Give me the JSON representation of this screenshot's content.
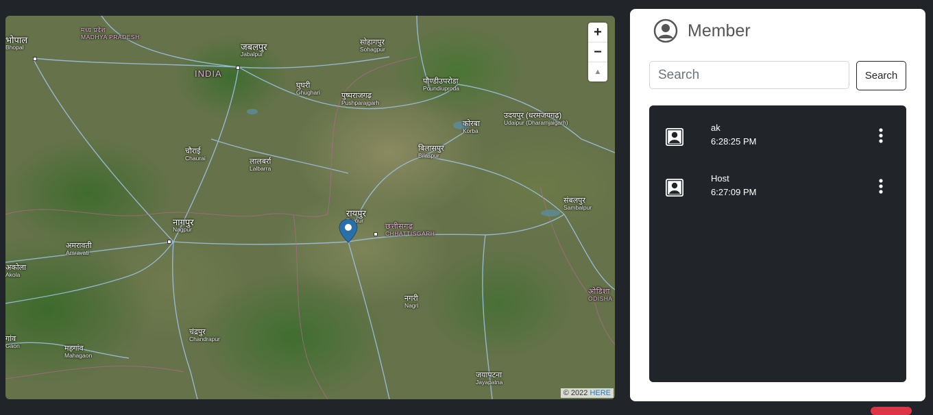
{
  "map": {
    "labels": {
      "bhopal_hi": "भोपाल",
      "bhopal": "Bhopal",
      "mp_hi": "मध्य प्रदेश",
      "mp": "MADHYA PRADESH",
      "jabalpur_hi": "जबलपुर",
      "jabalpur": "Jabalpur",
      "india": "INDIA",
      "sohagpur_hi": "सोहागपुर",
      "sohagpur": "Sohagpur",
      "ghughri_hi": "घुघरी",
      "ghughri": "Ghughari",
      "pushparajgarh_hi": "पुष्पराजगढ़",
      "pushparajgarh": "Pushparajgarh",
      "pondi_hi": "पौण्डीउपरोडा",
      "pondi": "Poundiuproda",
      "korba_hi": "कोरबा",
      "korba": "Korba",
      "udaipur_hi": "उदयपुर (धरमजयगढ़)",
      "udaipur": "Udaipur (Dharamjaigarh)",
      "chaurai_hi": "चौराई",
      "chaurai": "Chaurai",
      "lalbarra_hi": "लालबर्रा",
      "lalbarra": "Lalbarra",
      "bilaspur_hi": "बिलासपुर",
      "bilaspur": "Bilaspur",
      "nagpur_hi": "नागपुर",
      "nagpur": "Nagpur",
      "raipur_hi": "रायपुर",
      "raipur": "Raipur",
      "cg_hi": "छत्तीसगढ़",
      "cg": "CHHATTISGARH",
      "sambalpur_hi": "संबलपुर",
      "sambalpur": "Sambalpur",
      "amravati_hi": "अमरावती",
      "amravati": "Amravati",
      "akola_hi": "अकोला",
      "akola": "Akola",
      "odisha_hi": "ओडिशा",
      "odisha": "ODISHA",
      "nagri_hi": "नगरी",
      "nagri": "Nagri",
      "chandrapur_hi": "चंद्रपुर",
      "chandrapur": "Chandrapur",
      "mahagaon_hi": "महगांव",
      "mahagaon": "Mahagaon",
      "gaon_hi": "गांव",
      "gaon": "Gaon",
      "jayapatna_hi": "जयापटना",
      "jayapatna": "Jayapatna"
    },
    "zoom_in": "+",
    "zoom_out": "−",
    "compass": "▲",
    "attribution_prefix": "© 2022",
    "attribution_link": "HERE"
  },
  "panel": {
    "title": "Member",
    "search": {
      "placeholder": "Search",
      "value": ""
    },
    "search_button": "Search",
    "members": [
      {
        "name": "ak",
        "time": "6:28:25 PM"
      },
      {
        "name": "Host",
        "time": "6:27:09 PM"
      }
    ]
  },
  "colors": {
    "page_bg": "#212529",
    "panel_bg": "#ffffff",
    "member_list_bg": "#212529",
    "marker": "#2a6fa8"
  }
}
